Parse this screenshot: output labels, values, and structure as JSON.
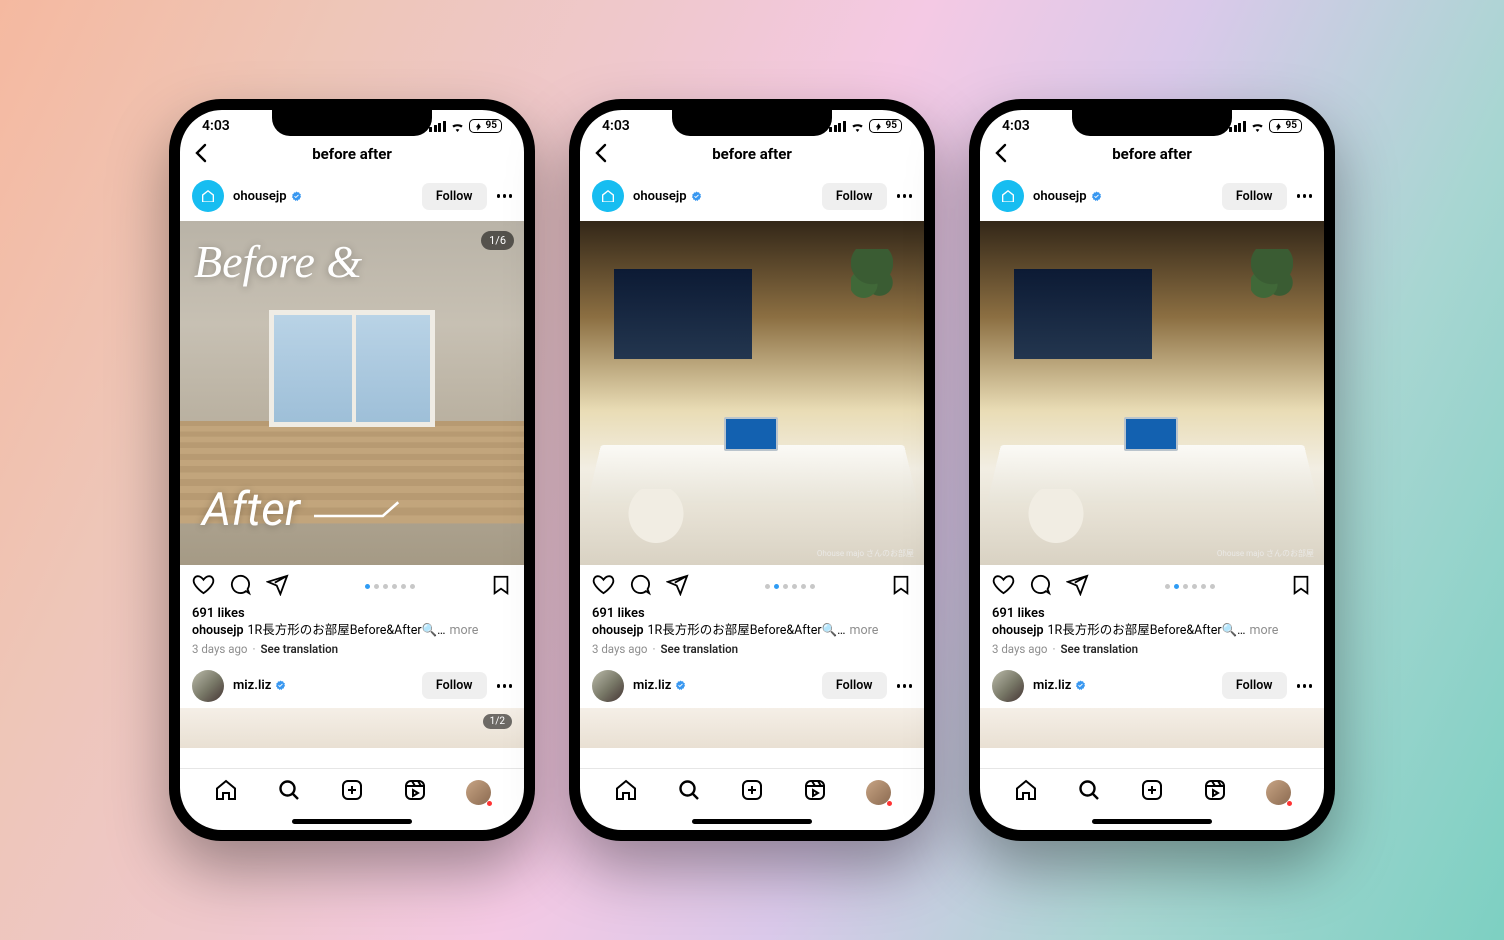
{
  "status": {
    "time": "4:03",
    "battery": "95"
  },
  "nav": {
    "title": "before after"
  },
  "post": {
    "username": "ohousejp",
    "follow_label": "Follow",
    "counter_text": "1/6",
    "overlay_top": "Before  &",
    "overlay_bottom": "After",
    "image_caption_small": "Ohouse majo さんのお部屋",
    "likes_text": "691 likes",
    "caption_user": "ohousejp",
    "caption_text": "1R長方形のお部屋Before&After🔍…",
    "more_label": "more",
    "age_text": "3 days ago",
    "translate_label": "See translation"
  },
  "pager": {
    "total": 6,
    "active_first": 1,
    "active_rest": 2
  },
  "post2": {
    "username": "miz.liz",
    "follow_label": "Follow",
    "preview_counter": "1/2"
  },
  "tabs": {}
}
